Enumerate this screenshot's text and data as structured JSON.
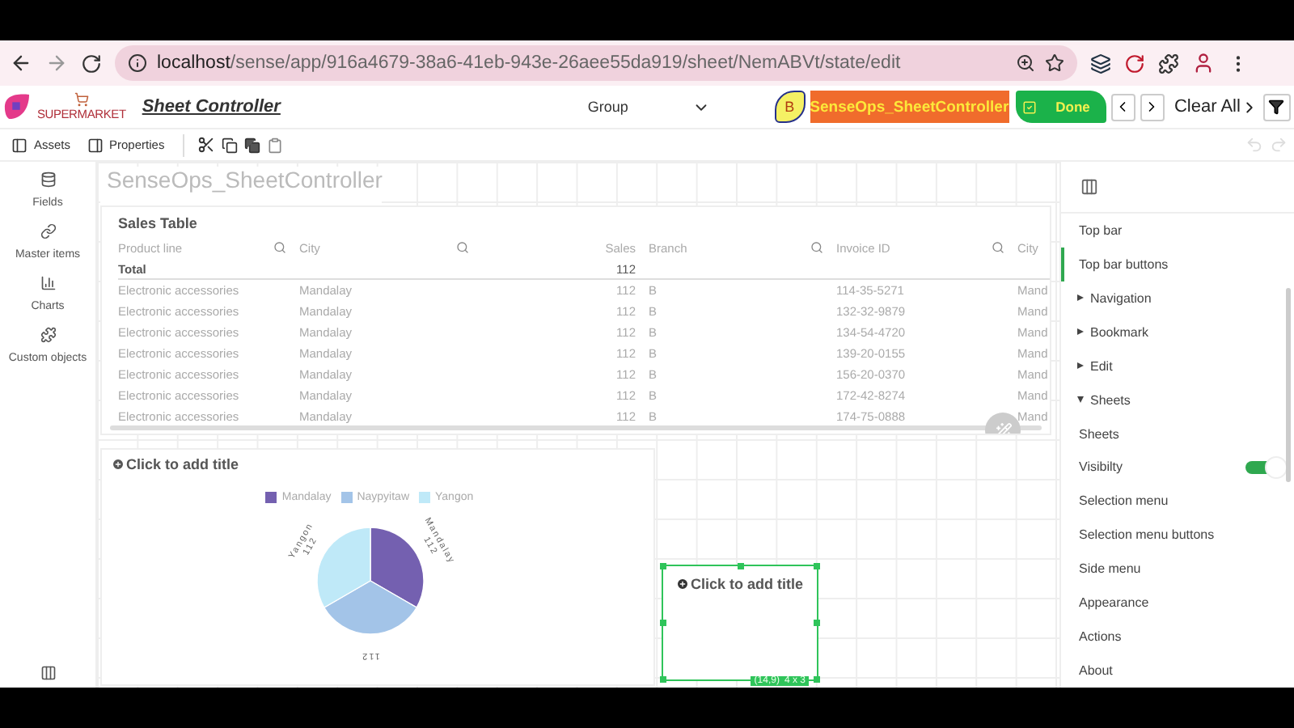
{
  "browser": {
    "address_host": "localhost",
    "address_path": "/sense/app/916a4679-38a6-41eb-943e-26aee55da919/sheet/NemABVt/state/edit"
  },
  "header": {
    "brand": "SUPERMARKET",
    "title": "Sheet Controller",
    "group_dropdown": "Group",
    "badge": "B",
    "app_button": "SenseOps_SheetController",
    "done_button": "Done",
    "clear_all": "Clear All"
  },
  "toolbar": {
    "items": [
      {
        "label": "Assets"
      },
      {
        "label": "Properties"
      }
    ]
  },
  "sidebar": {
    "items": [
      {
        "label": "Fields",
        "kind": "fields"
      },
      {
        "label": "Master items",
        "kind": "master"
      },
      {
        "label": "Charts",
        "kind": "charts"
      },
      {
        "label": "Custom objects",
        "kind": "custom"
      }
    ]
  },
  "sheet": {
    "title": "SenseOps_SheetController",
    "table": {
      "title": "Sales Table",
      "columns": [
        {
          "label": "Product line",
          "searchable": true,
          "kind": "text"
        },
        {
          "label": "City",
          "searchable": true,
          "kind": "text"
        },
        {
          "label": "Sales",
          "searchable": false,
          "kind": "number"
        },
        {
          "label": "Branch",
          "searchable": true,
          "kind": "text"
        },
        {
          "label": "Invoice ID",
          "searchable": true,
          "kind": "text"
        },
        {
          "label": "City",
          "searchable": false,
          "kind": "text"
        }
      ],
      "total": {
        "label": "Total",
        "sales": "112"
      },
      "rows": [
        [
          "Electronic accessories",
          "Mandalay",
          "112",
          "B",
          "114-35-5271",
          "Mand"
        ],
        [
          "Electronic accessories",
          "Mandalay",
          "112",
          "B",
          "132-32-9879",
          "Mand"
        ],
        [
          "Electronic accessories",
          "Mandalay",
          "112",
          "B",
          "134-54-4720",
          "Mand"
        ],
        [
          "Electronic accessories",
          "Mandalay",
          "112",
          "B",
          "139-20-0155",
          "Mand"
        ],
        [
          "Electronic accessories",
          "Mandalay",
          "112",
          "B",
          "156-20-0370",
          "Mand"
        ],
        [
          "Electronic accessories",
          "Mandalay",
          "112",
          "B",
          "172-42-8274",
          "Mand"
        ],
        [
          "Electronic accessories",
          "Mandalay",
          "112",
          "B",
          "174-75-0888",
          "Mand"
        ]
      ]
    },
    "pie": {
      "title": "Click to add title",
      "legend": [
        {
          "color": "#7460b0"
        },
        {
          "color": "#a3c4e8"
        },
        {
          "color": "#bfe9f8"
        }
      ],
      "slice_labels": [
        {
          "lines": [
            "Mandalay",
            "112"
          ]
        },
        {
          "lines": [
            "112"
          ]
        },
        {
          "lines": [
            "Yangon",
            "112"
          ]
        }
      ],
      "chart_data": {
        "type": "pie",
        "categories": [
          "Mandalay",
          "Naypyitaw",
          "Yangon"
        ],
        "series": [
          {
            "values": [
              112,
              112,
              112
            ]
          }
        ],
        "data_labels": true
      }
    },
    "new_object": {
      "title": "Click to add title",
      "position": "(14,9)",
      "size": "4 x 3"
    }
  },
  "properties_panel": {
    "items": [
      {
        "kind": "item",
        "label": "Top bar",
        "selected": false
      },
      {
        "kind": "item",
        "label": "Top bar buttons",
        "selected": true,
        "children": [
          {
            "kind": "group",
            "label": "Navigation",
            "expanded": false
          },
          {
            "kind": "group",
            "label": "Bookmark",
            "expanded": false
          },
          {
            "kind": "group",
            "label": "Edit",
            "expanded": false
          },
          {
            "kind": "group",
            "label": "Sheets",
            "expanded": true,
            "children": [
              {
                "kind": "label",
                "label": "Sheets"
              },
              {
                "kind": "toggle",
                "label": "Visibilty",
                "on": true
              }
            ]
          }
        ]
      },
      {
        "kind": "item",
        "label": "Selection menu",
        "selected": false
      },
      {
        "kind": "item",
        "label": "Selection menu buttons",
        "selected": false
      },
      {
        "kind": "item",
        "label": "Side menu",
        "selected": false
      },
      {
        "kind": "item",
        "label": "Appearance",
        "selected": false
      },
      {
        "kind": "item",
        "label": "Actions",
        "selected": false
      },
      {
        "kind": "item",
        "label": "About",
        "selected": false
      }
    ]
  }
}
